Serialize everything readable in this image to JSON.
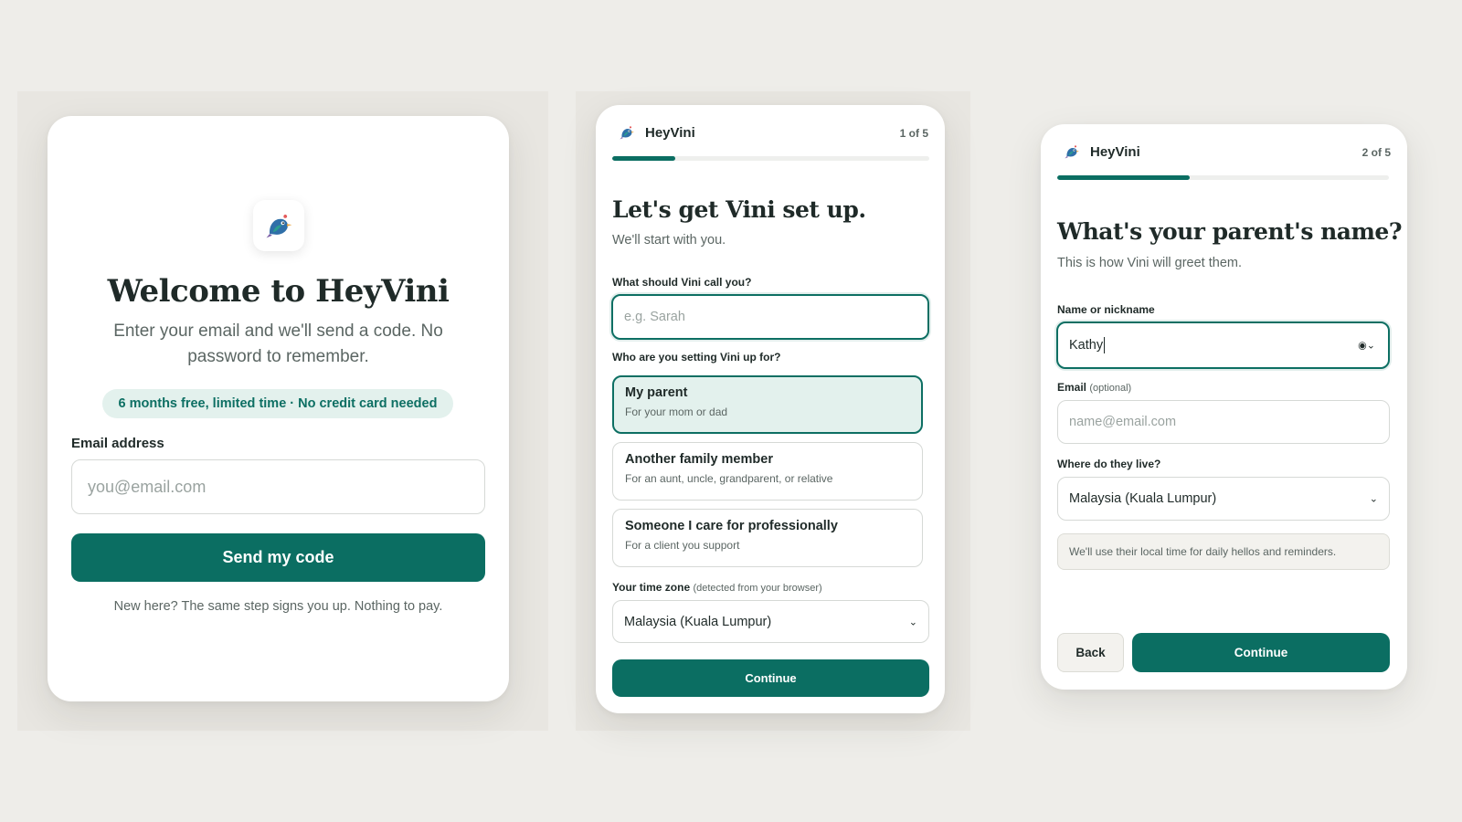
{
  "login": {
    "title": "Welcome to HeyVini",
    "subtitle": "Enter your email and we'll send a code. No password to remember.",
    "promo_badge": "6 months free, limited time · No credit card needed",
    "email_label": "Email address",
    "email_placeholder": "you@email.com",
    "submit_label": "Send my code",
    "footer_note": "New here? The same step signs you up. Nothing to pay."
  },
  "setup_step1": {
    "brand": "HeyVini",
    "step": "1 of 5",
    "progress": 0.2,
    "title": "Let's get Vini set up.",
    "subtitle": "We'll start with you.",
    "name_label": "What should Vini call you?",
    "name_placeholder": "e.g. Sarah",
    "who_label": "Who are you setting Vini up for?",
    "options": [
      {
        "title": "My parent",
        "desc": "For your mom or dad",
        "selected": true
      },
      {
        "title": "Another family member",
        "desc": "For an aunt, uncle, grandparent, or relative",
        "selected": false
      },
      {
        "title": "Someone I care for professionally",
        "desc": "For a client you support",
        "selected": false
      }
    ],
    "timezone_label": "Your time zone",
    "timezone_hint": "(detected from your browser)",
    "timezone_value": "Malaysia (Kuala Lumpur)",
    "continue_label": "Continue"
  },
  "setup_step2": {
    "brand": "HeyVini",
    "step": "2 of 5",
    "progress": 0.4,
    "title": "What's your parent's name?",
    "subtitle": "This is how Vini will greet them.",
    "name_label": "Name or nickname",
    "name_value": "Kathy",
    "email_label": "Email",
    "email_hint": "(optional)",
    "email_placeholder": "name@email.com",
    "location_label": "Where do they live?",
    "location_value": "Malaysia (Kuala Lumpur)",
    "info_note": "We'll use their local time for daily hellos and reminders.",
    "back_label": "Back",
    "continue_label": "Continue"
  },
  "colors": {
    "accent": "#0b6e62",
    "accent_light": "#e3f1ed",
    "background": "#eeede9"
  },
  "icons": {
    "logo": "bird-logo-icon",
    "select": "chevron-down-icon",
    "autofill": "contact-autofill-icon"
  }
}
